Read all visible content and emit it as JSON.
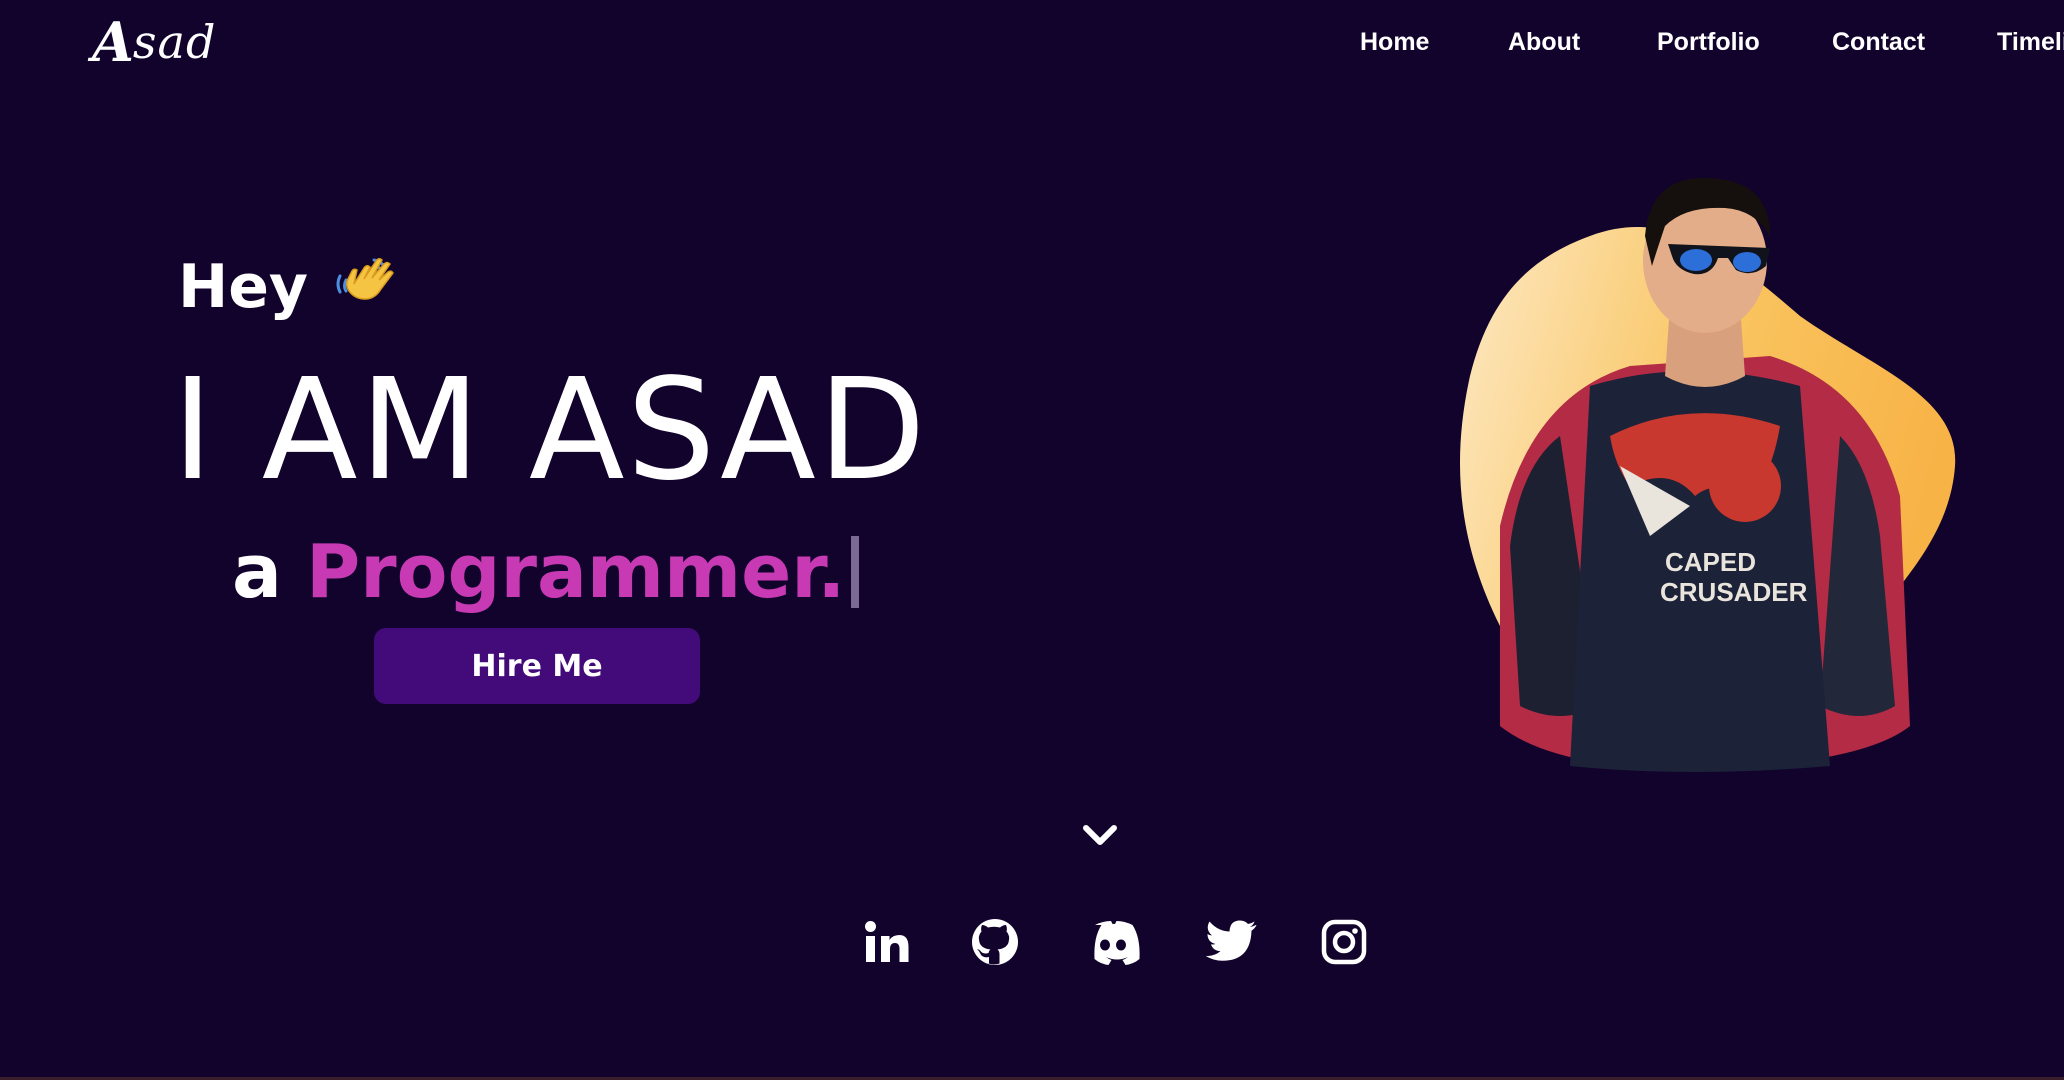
{
  "header": {
    "logo_text": "sad",
    "logo_mark": "A",
    "nav": [
      {
        "label": "Home"
      },
      {
        "label": "About"
      },
      {
        "label": "Portfolio"
      },
      {
        "label": "Contact"
      },
      {
        "label": "Timeli"
      }
    ]
  },
  "hero": {
    "greeting": "Hey",
    "greeting_icon": "waving-hand-icon",
    "title": "I AM ASAD",
    "subtitle_prefix": "a",
    "subtitle_role": "Programmer.",
    "hire_label": "Hire Me",
    "colors": {
      "background": "#12032c",
      "accent": "#c839b4",
      "button": "#430a7a",
      "blob": "#f8b347"
    }
  },
  "scroll": {
    "icon": "chevron-down-icon"
  },
  "socials": [
    {
      "icon": "linkedin-icon"
    },
    {
      "icon": "github-icon"
    },
    {
      "icon": "discord-icon"
    },
    {
      "icon": "twitter-icon"
    },
    {
      "icon": "instagram-icon"
    }
  ]
}
